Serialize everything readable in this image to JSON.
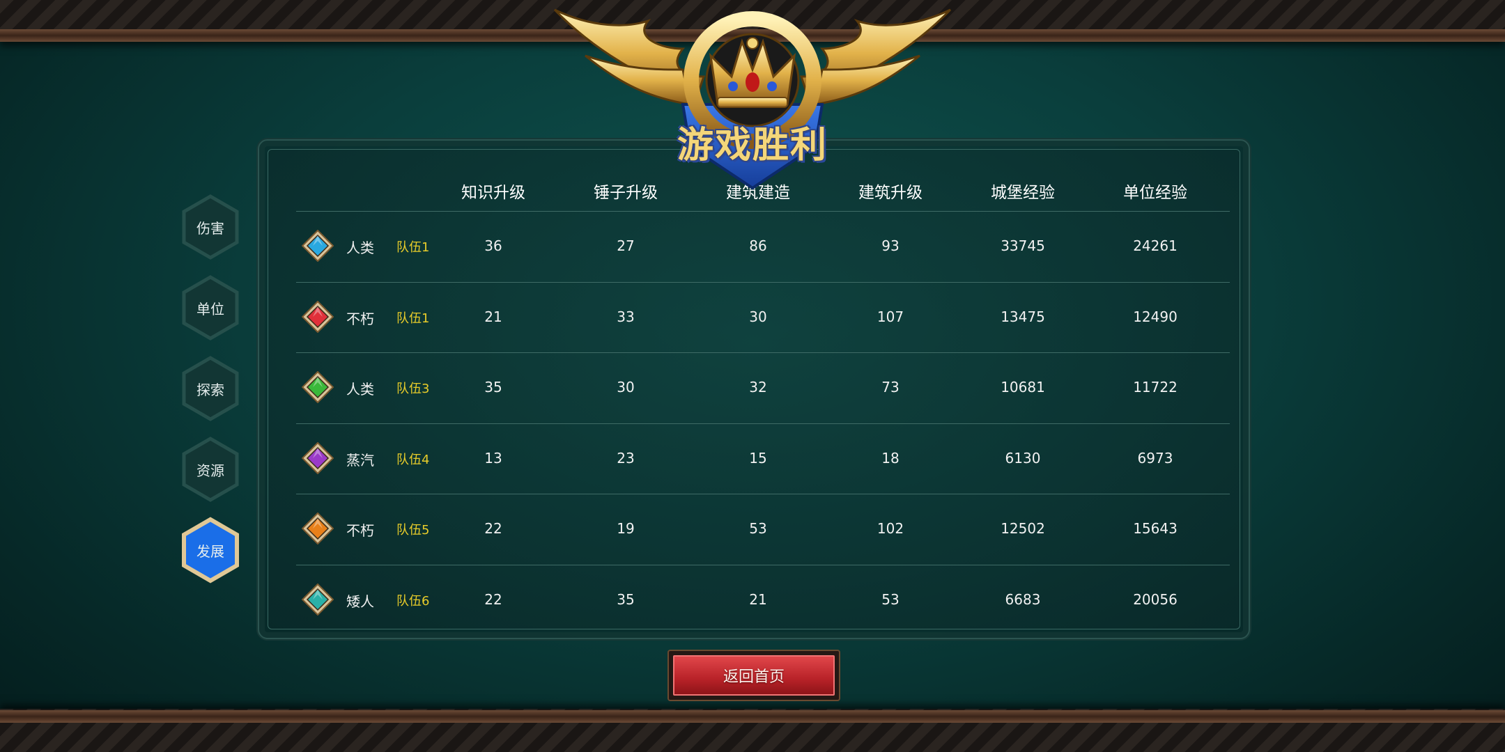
{
  "emblem": {
    "title": "游戏胜利",
    "icon": "winged-crown-icon"
  },
  "nav": {
    "items": [
      {
        "label": "伤害",
        "active": false
      },
      {
        "label": "单位",
        "active": false
      },
      {
        "label": "探索",
        "active": false
      },
      {
        "label": "资源",
        "active": false
      },
      {
        "label": "发展",
        "active": true
      }
    ]
  },
  "table": {
    "headers": [
      "知识升级",
      "锤子升级",
      "建筑建造",
      "建筑升级",
      "城堡经验",
      "单位经验"
    ],
    "rows": [
      {
        "gem_color": "#29a8e0",
        "race": "人类",
        "team": "队伍1",
        "values": [
          "36",
          "27",
          "86",
          "93",
          "33745",
          "24261"
        ]
      },
      {
        "gem_color": "#e0303a",
        "race": "不朽",
        "team": "队伍1",
        "values": [
          "21",
          "33",
          "30",
          "107",
          "13475",
          "12490"
        ]
      },
      {
        "gem_color": "#3ab83a",
        "race": "人类",
        "team": "队伍3",
        "values": [
          "35",
          "30",
          "32",
          "73",
          "10681",
          "11722"
        ]
      },
      {
        "gem_color": "#9a3ac8",
        "race": "蒸汽",
        "team": "队伍4",
        "values": [
          "13",
          "23",
          "15",
          "18",
          "6130",
          "6973"
        ]
      },
      {
        "gem_color": "#e8801a",
        "race": "不朽",
        "team": "队伍5",
        "values": [
          "22",
          "19",
          "53",
          "102",
          "12502",
          "15643"
        ]
      },
      {
        "gem_color": "#2ab0a8",
        "race": "矮人",
        "team": "队伍6",
        "values": [
          "22",
          "35",
          "21",
          "53",
          "6683",
          "20056"
        ]
      }
    ]
  },
  "return_button": {
    "label": "返回首页"
  },
  "colors": {
    "team_text": "#e8cc2a",
    "active_nav": "#1a6ee8",
    "button_red": "#c8262c"
  }
}
